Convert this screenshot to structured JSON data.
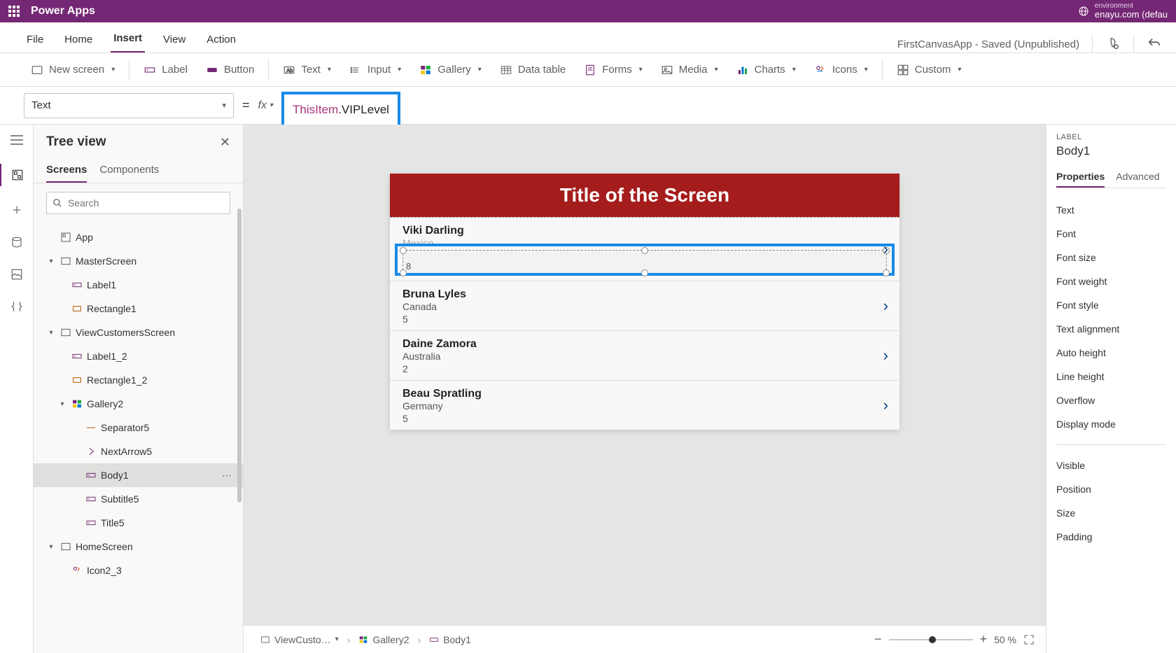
{
  "topbar": {
    "app_name": "Power Apps",
    "environment_label": "environment",
    "environment_name": "enayu.com (defau"
  },
  "menubar": {
    "items": [
      "File",
      "Home",
      "Insert",
      "View",
      "Action"
    ],
    "active_index": 2,
    "status_text": "FirstCanvasApp - Saved (Unpublished)"
  },
  "ribbon": {
    "new_screen": "New screen",
    "label": "Label",
    "button": "Button",
    "text": "Text",
    "input": "Input",
    "gallery": "Gallery",
    "data_table": "Data table",
    "forms": "Forms",
    "media": "Media",
    "charts": "Charts",
    "icons": "Icons",
    "custom": "Custom"
  },
  "formulabar": {
    "property_selected": "Text",
    "fx_label": "fx",
    "formula_thisitem": "ThisItem",
    "formula_rest": ".VIPLevel"
  },
  "tree": {
    "title": "Tree view",
    "tabs": [
      "Screens",
      "Components"
    ],
    "active_tab_index": 0,
    "search_placeholder": "Search",
    "nodes": [
      {
        "depth": 0,
        "caret": "",
        "icon": "app",
        "label": "App"
      },
      {
        "depth": 0,
        "caret": "v",
        "icon": "screen",
        "label": "MasterScreen"
      },
      {
        "depth": 1,
        "caret": "",
        "icon": "label",
        "label": "Label1"
      },
      {
        "depth": 1,
        "caret": "",
        "icon": "rect",
        "label": "Rectangle1"
      },
      {
        "depth": 0,
        "caret": "v",
        "icon": "screen",
        "label": "ViewCustomersScreen"
      },
      {
        "depth": 1,
        "caret": "",
        "icon": "label",
        "label": "Label1_2"
      },
      {
        "depth": 1,
        "caret": "",
        "icon": "rect",
        "label": "Rectangle1_2"
      },
      {
        "depth": 1,
        "caret": "v",
        "icon": "gallery",
        "label": "Gallery2"
      },
      {
        "depth": 2,
        "caret": "",
        "icon": "sep",
        "label": "Separator5"
      },
      {
        "depth": 2,
        "caret": "",
        "icon": "arrow",
        "label": "NextArrow5"
      },
      {
        "depth": 2,
        "caret": "",
        "icon": "label",
        "label": "Body1",
        "selected": true,
        "more": true
      },
      {
        "depth": 2,
        "caret": "",
        "icon": "label",
        "label": "Subtitle5"
      },
      {
        "depth": 2,
        "caret": "",
        "icon": "label",
        "label": "Title5"
      },
      {
        "depth": 0,
        "caret": "v",
        "icon": "screen",
        "label": "HomeScreen"
      },
      {
        "depth": 1,
        "caret": "",
        "icon": "icon",
        "label": "Icon2_3"
      }
    ]
  },
  "canvas": {
    "header_title": "Title of the Screen",
    "items": [
      {
        "name": "Viki  Darling",
        "country": "Mexico",
        "vip": "8",
        "selected": true
      },
      {
        "name": "Bruna  Lyles",
        "country": "Canada",
        "vip": "5"
      },
      {
        "name": "Daine  Zamora",
        "country": "Australia",
        "vip": "2"
      },
      {
        "name": "Beau  Spratling",
        "country": "Germany",
        "vip": "5"
      }
    ]
  },
  "breadcrumb": {
    "items": [
      "ViewCusto…",
      "Gallery2",
      "Body1"
    ],
    "zoom_label": "50  %"
  },
  "props": {
    "type_label": "LABEL",
    "element_name": "Body1",
    "tabs": [
      "Properties",
      "Advanced"
    ],
    "active_tab_index": 0,
    "rows_group1": [
      "Text",
      "Font",
      "Font size",
      "Font weight",
      "Font style",
      "Text alignment",
      "Auto height",
      "Line height",
      "Overflow",
      "Display mode"
    ],
    "rows_group2": [
      "Visible",
      "Position",
      "Size",
      "Padding"
    ]
  }
}
